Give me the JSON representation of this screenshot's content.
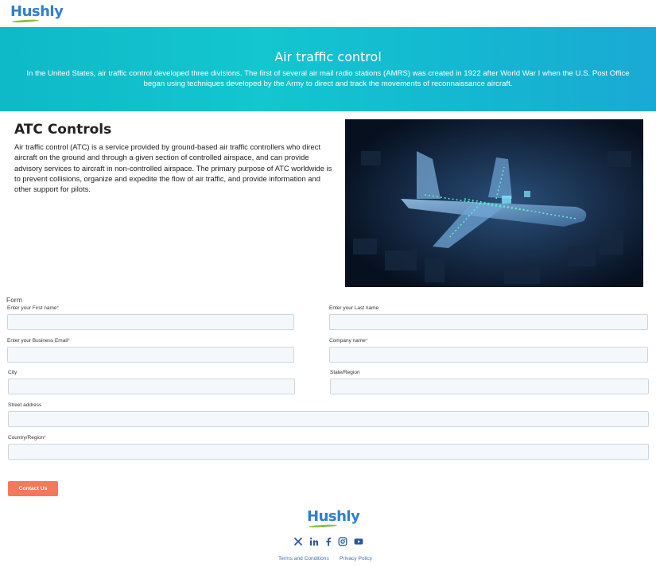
{
  "brand": {
    "name": "Hushly",
    "color": "#2f7fd0",
    "accent": "#8bc34a"
  },
  "hero": {
    "title": "Air traffic control",
    "text": "In the United States, air traffic control developed three divisions. The first of several air mail radio stations (AMRS) was created in 1922 after World War I when the U.S. Post Office began using techniques developed by the Army to direct and track the movements of reconnaissance aircraft."
  },
  "section": {
    "title": "ATC Controls",
    "text": "Air traffic control (ATC) is a service provided by ground-based air traffic controllers who direct aircraft on the ground and through a given section of controlled airspace, and can provide advisory services to aircraft in non-controlled airspace. The primary purpose of ATC worldwide is to prevent collisions, organize and expedite the flow of air traffic, and provide information and other support for pilots."
  },
  "form": {
    "title": "Form",
    "first_name": {
      "label": "Enter your First name",
      "required": "*"
    },
    "last_name": {
      "label": "Enter your Last name"
    },
    "email": {
      "label": "Enter your Business Email",
      "required": "*"
    },
    "company": {
      "label": "Company name",
      "required": "*"
    },
    "city": {
      "label": "City"
    },
    "state": {
      "label": "State/Region"
    },
    "street": {
      "label": "Street address"
    },
    "country": {
      "label": "Country/Region",
      "required": "*"
    },
    "submit": "Contact Us",
    "submit_color": "#f4795b"
  },
  "footer": {
    "social": [
      "x-icon",
      "linkedin-icon",
      "facebook-icon",
      "instagram-icon",
      "youtube-icon"
    ],
    "links": {
      "terms": "Terms and Conditions",
      "privacy": "Privacy Policy"
    }
  }
}
